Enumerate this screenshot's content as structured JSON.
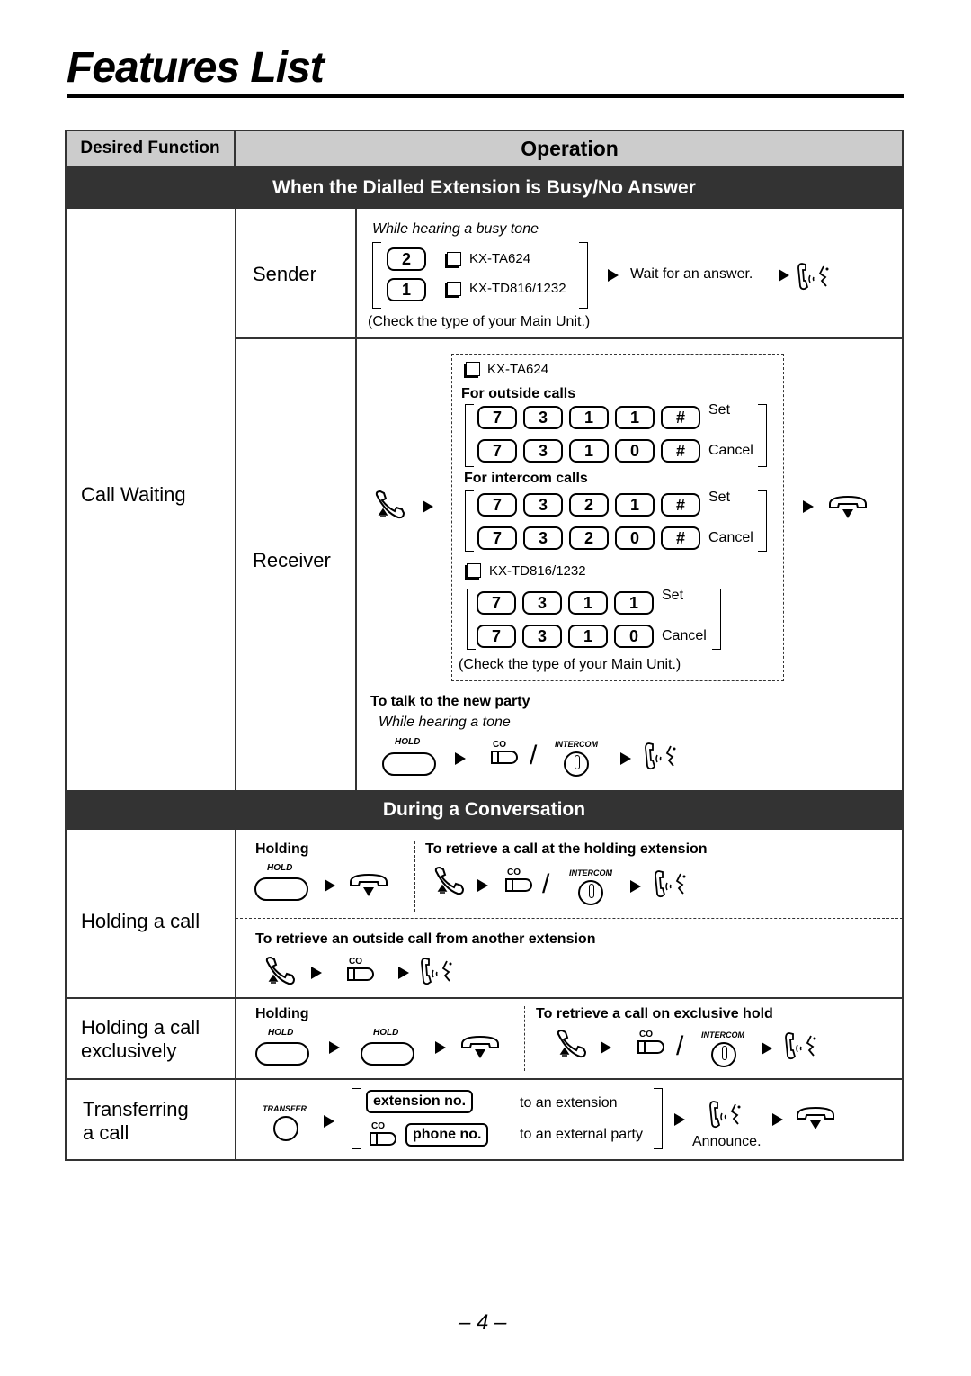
{
  "page": {
    "title": "Features List",
    "page_number": "– 4 –"
  },
  "table": {
    "header": {
      "desired_function": "Desired Function",
      "operation": "Operation"
    },
    "sections": [
      {
        "title": "When the Dialled Extension is Busy/No Answer"
      },
      {
        "title": "During a Conversation"
      }
    ]
  },
  "call_waiting": {
    "function": "Call Waiting",
    "sender": {
      "label": "Sender",
      "condition": "While hearing a busy tone",
      "options": [
        {
          "key": "2",
          "model": "KX-TA624"
        },
        {
          "key": "1",
          "model": "KX-TD816/1232"
        }
      ],
      "wait_text": "Wait for an answer.",
      "note": "(Check the type of your Main Unit.)"
    },
    "receiver": {
      "label": "Receiver",
      "model_a": "KX-TA624",
      "outside_calls_label": "For outside calls",
      "outside_calls": [
        {
          "keys": [
            "7",
            "3",
            "1",
            "1",
            "#"
          ],
          "action": "Set"
        },
        {
          "keys": [
            "7",
            "3",
            "1",
            "0",
            "#"
          ],
          "action": "Cancel"
        }
      ],
      "intercom_calls_label": "For intercom calls",
      "intercom_calls": [
        {
          "keys": [
            "7",
            "3",
            "2",
            "1",
            "#"
          ],
          "action": "Set"
        },
        {
          "keys": [
            "7",
            "3",
            "2",
            "0",
            "#"
          ],
          "action": "Cancel"
        }
      ],
      "model_b": "KX-TD816/1232",
      "model_b_codes": [
        {
          "keys": [
            "7",
            "3",
            "1",
            "1"
          ],
          "action": "Set"
        },
        {
          "keys": [
            "7",
            "3",
            "1",
            "0"
          ],
          "action": "Cancel"
        }
      ],
      "note": "(Check the type of your Main Unit.)",
      "new_party_label": "To talk to the new party",
      "new_party_condition": "While hearing a tone"
    }
  },
  "buttons": {
    "hold": "HOLD",
    "co": "CO",
    "intercom": "INTERCOM",
    "transfer": "TRANSFER"
  },
  "icons": {
    "off_hook": "handset-off-hook-icon",
    "on_hook": "handset-on-hook-icon",
    "talk": "talk-icon",
    "arrow": "▶",
    "slash": "/"
  },
  "holding_call": {
    "function": "Holding a call",
    "holding_label": "Holding",
    "retrieve_holding_label": "To retrieve a call at the holding extension",
    "retrieve_outside_label": "To retrieve an outside call from another extension"
  },
  "holding_exclusive": {
    "function_line1": "Holding a call",
    "function_line2": "exclusively",
    "holding_label": "Holding",
    "retrieve_label": "To retrieve a call on exclusive hold"
  },
  "transferring": {
    "function_line1": "Transferring",
    "function_line2": "a call",
    "extension_pill": "extension no.",
    "extension_desc": "to an extension",
    "phone_pill": "phone no.",
    "phone_desc": "to an external party",
    "announce": "Announce."
  }
}
